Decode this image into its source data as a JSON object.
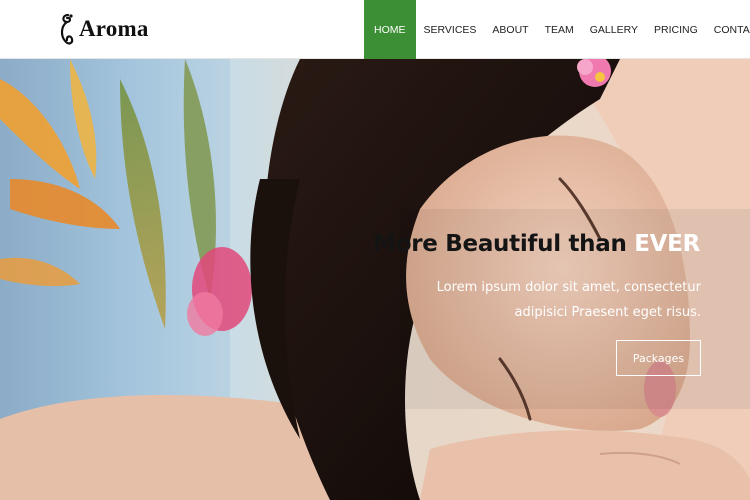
{
  "brand": {
    "name": "Aroma",
    "logo_icon": "aroma-swirl-icon"
  },
  "nav": {
    "items": [
      {
        "label": "HOME",
        "active": true
      },
      {
        "label": "SERVICES"
      },
      {
        "label": "ABOUT"
      },
      {
        "label": "TEAM"
      },
      {
        "label": "GALLERY"
      },
      {
        "label": "PRICING"
      },
      {
        "label": "CONTACT"
      }
    ],
    "active_color": "#3c8f35"
  },
  "hero": {
    "title_main": "More Beautiful than ",
    "title_accent": "EVER",
    "subtitle": "Lorem ipsum dolor sit amet, consectetur adipisici Praesent eget risus.",
    "button_label": "Packages",
    "image": "spa-woman-resting-photo"
  }
}
